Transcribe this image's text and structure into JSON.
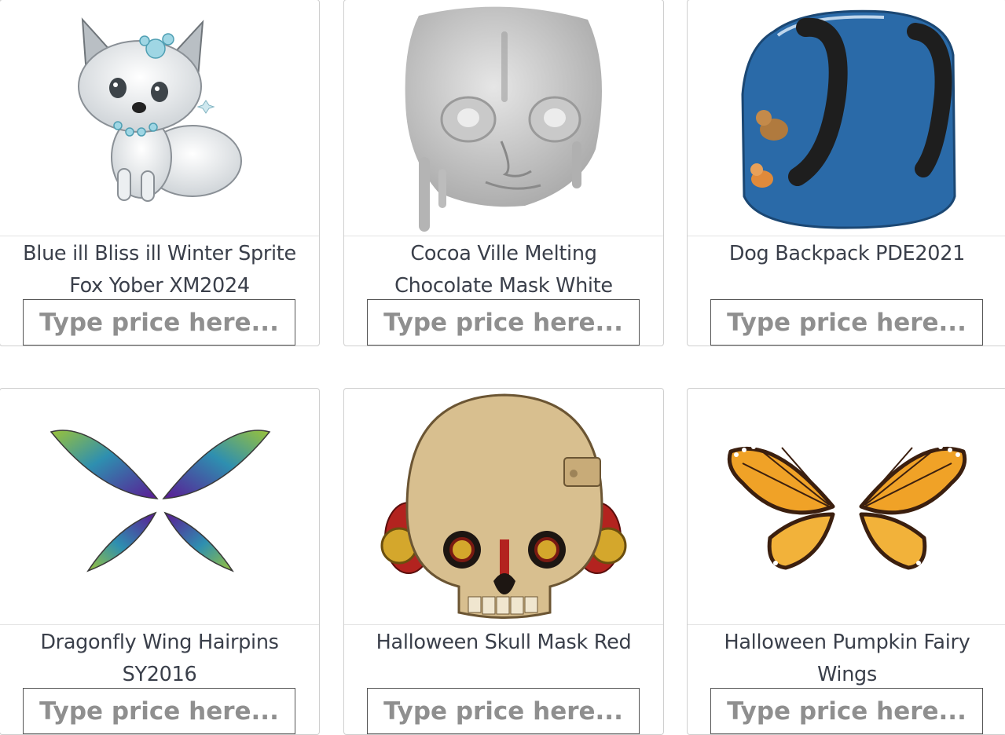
{
  "items": [
    {
      "name": "Blue ill Bliss ill Winter Sprite Fox Yober XM2024",
      "image_icon": "winter-fox-icon",
      "price_value": "",
      "price_placeholder": "Type price here..."
    },
    {
      "name": "Cocoa Ville Melting Chocolate Mask White",
      "image_icon": "melting-mask-icon",
      "price_value": "",
      "price_placeholder": "Type price here..."
    },
    {
      "name": "Dog Backpack PDE2021",
      "image_icon": "backpack-icon",
      "price_value": "",
      "price_placeholder": "Type price here..."
    },
    {
      "name": "Dragonfly Wing Hairpins SY2016",
      "image_icon": "dragonfly-wings-icon",
      "price_value": "",
      "price_placeholder": "Type price here..."
    },
    {
      "name": "Halloween Skull Mask Red",
      "image_icon": "skull-mask-icon",
      "price_value": "",
      "price_placeholder": "Type price here..."
    },
    {
      "name": "Halloween Pumpkin Fairy Wings",
      "image_icon": "butterfly-wings-icon",
      "price_value": "",
      "price_placeholder": "Type price here..."
    }
  ],
  "colors": {
    "text": "#3a3f4a",
    "border": "#cfcfcf",
    "input_border": "#555555",
    "placeholder": "#8f8f8f"
  }
}
